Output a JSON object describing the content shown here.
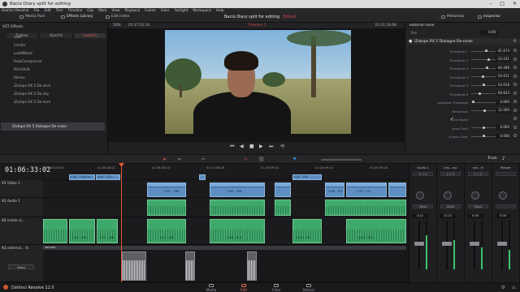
{
  "window": {
    "title": "Bacio Diary split for editing"
  },
  "menu": [
    "DaVinci Resolve",
    "File",
    "Edit",
    "Trim",
    "Timeline",
    "Clip",
    "Mark",
    "View",
    "Playback",
    "Fusion",
    "Color",
    "Fairlight",
    "Workspace",
    "Help"
  ],
  "toolbar": {
    "media_pool": "Media Pool",
    "effects_library": "Effects Library",
    "edit_index": "Edit Index",
    "metadata": "Metadata",
    "inspector": "Inspector"
  },
  "project": {
    "name": "Bacio Diary split for editing",
    "status": "Edited"
  },
  "fx": {
    "tabs": [
      "Toolbox",
      "OpenFX",
      "AudioFX"
    ],
    "active_tab": "AudioFX",
    "header": "VST Effects",
    "items": [
      "Gain",
      "Limiter",
      "LowMBand",
      "PeakCompressor",
      "PitchShift",
      "Stereo",
      "iZotope RX 5 De-click",
      "iZotope RX 5 De-clip",
      "iZotope RX 5 De-hum",
      "iZotope RX 5 Dialogue De-noise"
    ],
    "selected_index": 9
  },
  "viewer": {
    "zoom": "50%",
    "timecode_in": "01:17:51:14",
    "timeline_name": "Timeline 1",
    "timecode_out": "01:21:16:06"
  },
  "inspector": {
    "clip_title": "external noise",
    "plugin_title": "iZotope RX 5 Dialogue De-noise",
    "pan_label": "Pan",
    "pan_value": "0.00",
    "params": [
      {
        "label": "Threshold 1",
        "value": "-41.674",
        "level": 0.62
      },
      {
        "label": "Threshold 2",
        "value": "-32.031",
        "level": 0.72
      },
      {
        "label": "Threshold 3",
        "value": "-40.496",
        "level": 0.63
      },
      {
        "label": "Threshold 4",
        "value": "-54.611",
        "level": 0.48
      },
      {
        "label": "Threshold 5",
        "value": "-54.018",
        "level": 0.49
      },
      {
        "label": "Threshold 6",
        "value": "-69.833",
        "level": 0.32
      },
      {
        "label": "Adaptive Threshold",
        "value": "0.000",
        "level": 0.02
      },
      {
        "label": "Reduction",
        "value": "12.000",
        "level": 0.55
      },
      {
        "label": "Auto Model",
        "value": "",
        "level": null
      },
      {
        "label": "Input Gain",
        "value": "0.000",
        "level": 0.5
      },
      {
        "label": "Output Gain",
        "value": "0.000",
        "level": 0.5
      }
    ]
  },
  "timeline": {
    "timecode": "01:06:33:02",
    "ruler": [
      "01:03:04:00",
      "01:04:08:02",
      "01:08:08:10",
      "01:12:08:18",
      "01:16:09:02",
      "01:20:09:10",
      "01:24:09:18"
    ],
    "tracks": [
      {
        "tag": "V1",
        "name": "Video 1"
      },
      {
        "tag": "A1",
        "name": "Audio 1"
      },
      {
        "tag": "A2",
        "name": "inside ro..."
      },
      {
        "tag": "A3",
        "name": "external... fx"
      }
    ],
    "clips_video": [
      "1:18 - 144.h.d...",
      "1:46 - 172...",
      "1:22 - 166...",
      "1:46 - 158",
      "1:48 - 210",
      "1:22 - 211",
      "1:25 - 162"
    ],
    "clips_audio": [
      "1:18 - 144...",
      "1:21 - 146...",
      "1:22 - 145",
      "1:46 - 210",
      "1:26 - 171",
      "1:22 - 210"
    ],
    "clip_a3": "Volume",
    "track_mode": "Track",
    "a3_dropdown": "Read"
  },
  "mixer": {
    "channels": [
      {
        "name": "Audio 1",
        "route": "1 + 2",
        "mode": "Read",
        "fader": "4.12",
        "meter": 0.7
      },
      {
        "name": "insi...roo",
        "route": "1 + 2",
        "mode": "Read",
        "fader": "13.14",
        "meter": 0.6
      },
      {
        "name": "ext...fx",
        "route": "1 + 2",
        "mode": "Read",
        "fader": "0.00",
        "meter": 0.45
      },
      {
        "name": "Master",
        "route": "",
        "mode": "",
        "fader": "0.00",
        "meter": 0.4
      }
    ]
  },
  "status": {
    "app": "DaVinci Resolve 12.5"
  },
  "pages": [
    "Media",
    "Edit",
    "Color",
    "Deliver"
  ],
  "active_page": "Edit"
}
